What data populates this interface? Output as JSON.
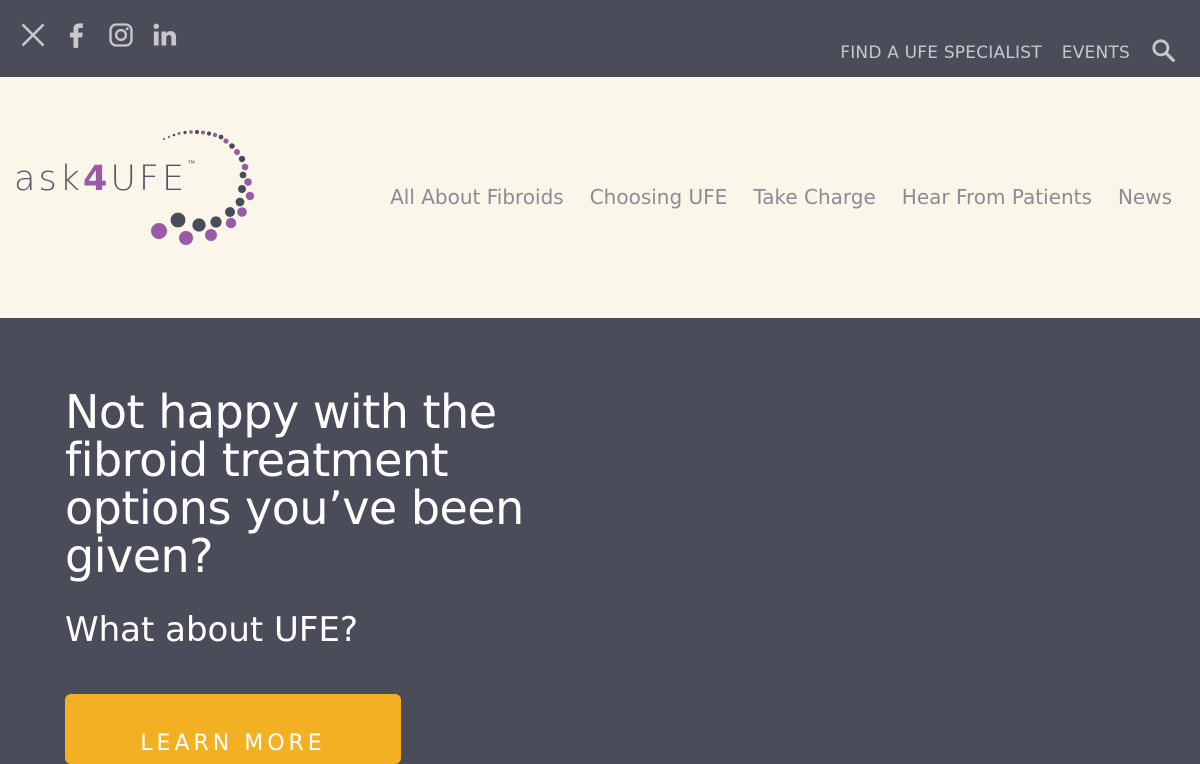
{
  "topbar": {
    "social": [
      "x-icon",
      "facebook-icon",
      "instagram-icon",
      "linkedin-icon"
    ],
    "links": [
      "FIND A UFE SPECIALIST",
      "EVENTS"
    ]
  },
  "logo": {
    "prefix": "ask",
    "number": "4",
    "suffix": "UFE",
    "tm": "™"
  },
  "nav": [
    "All About Fibroids",
    "Choosing UFE",
    "Take Charge",
    "Hear From Patients",
    "News"
  ],
  "hero": {
    "headline": "Not happy with the fibroid treatment options you’ve been given?",
    "subhead": "What about UFE?",
    "cta": "LEARN MORE"
  },
  "colors": {
    "dark": "#4a4d59",
    "cream": "#faf6e9",
    "purple": "#9a5aa8",
    "cta": "#f2b022"
  }
}
